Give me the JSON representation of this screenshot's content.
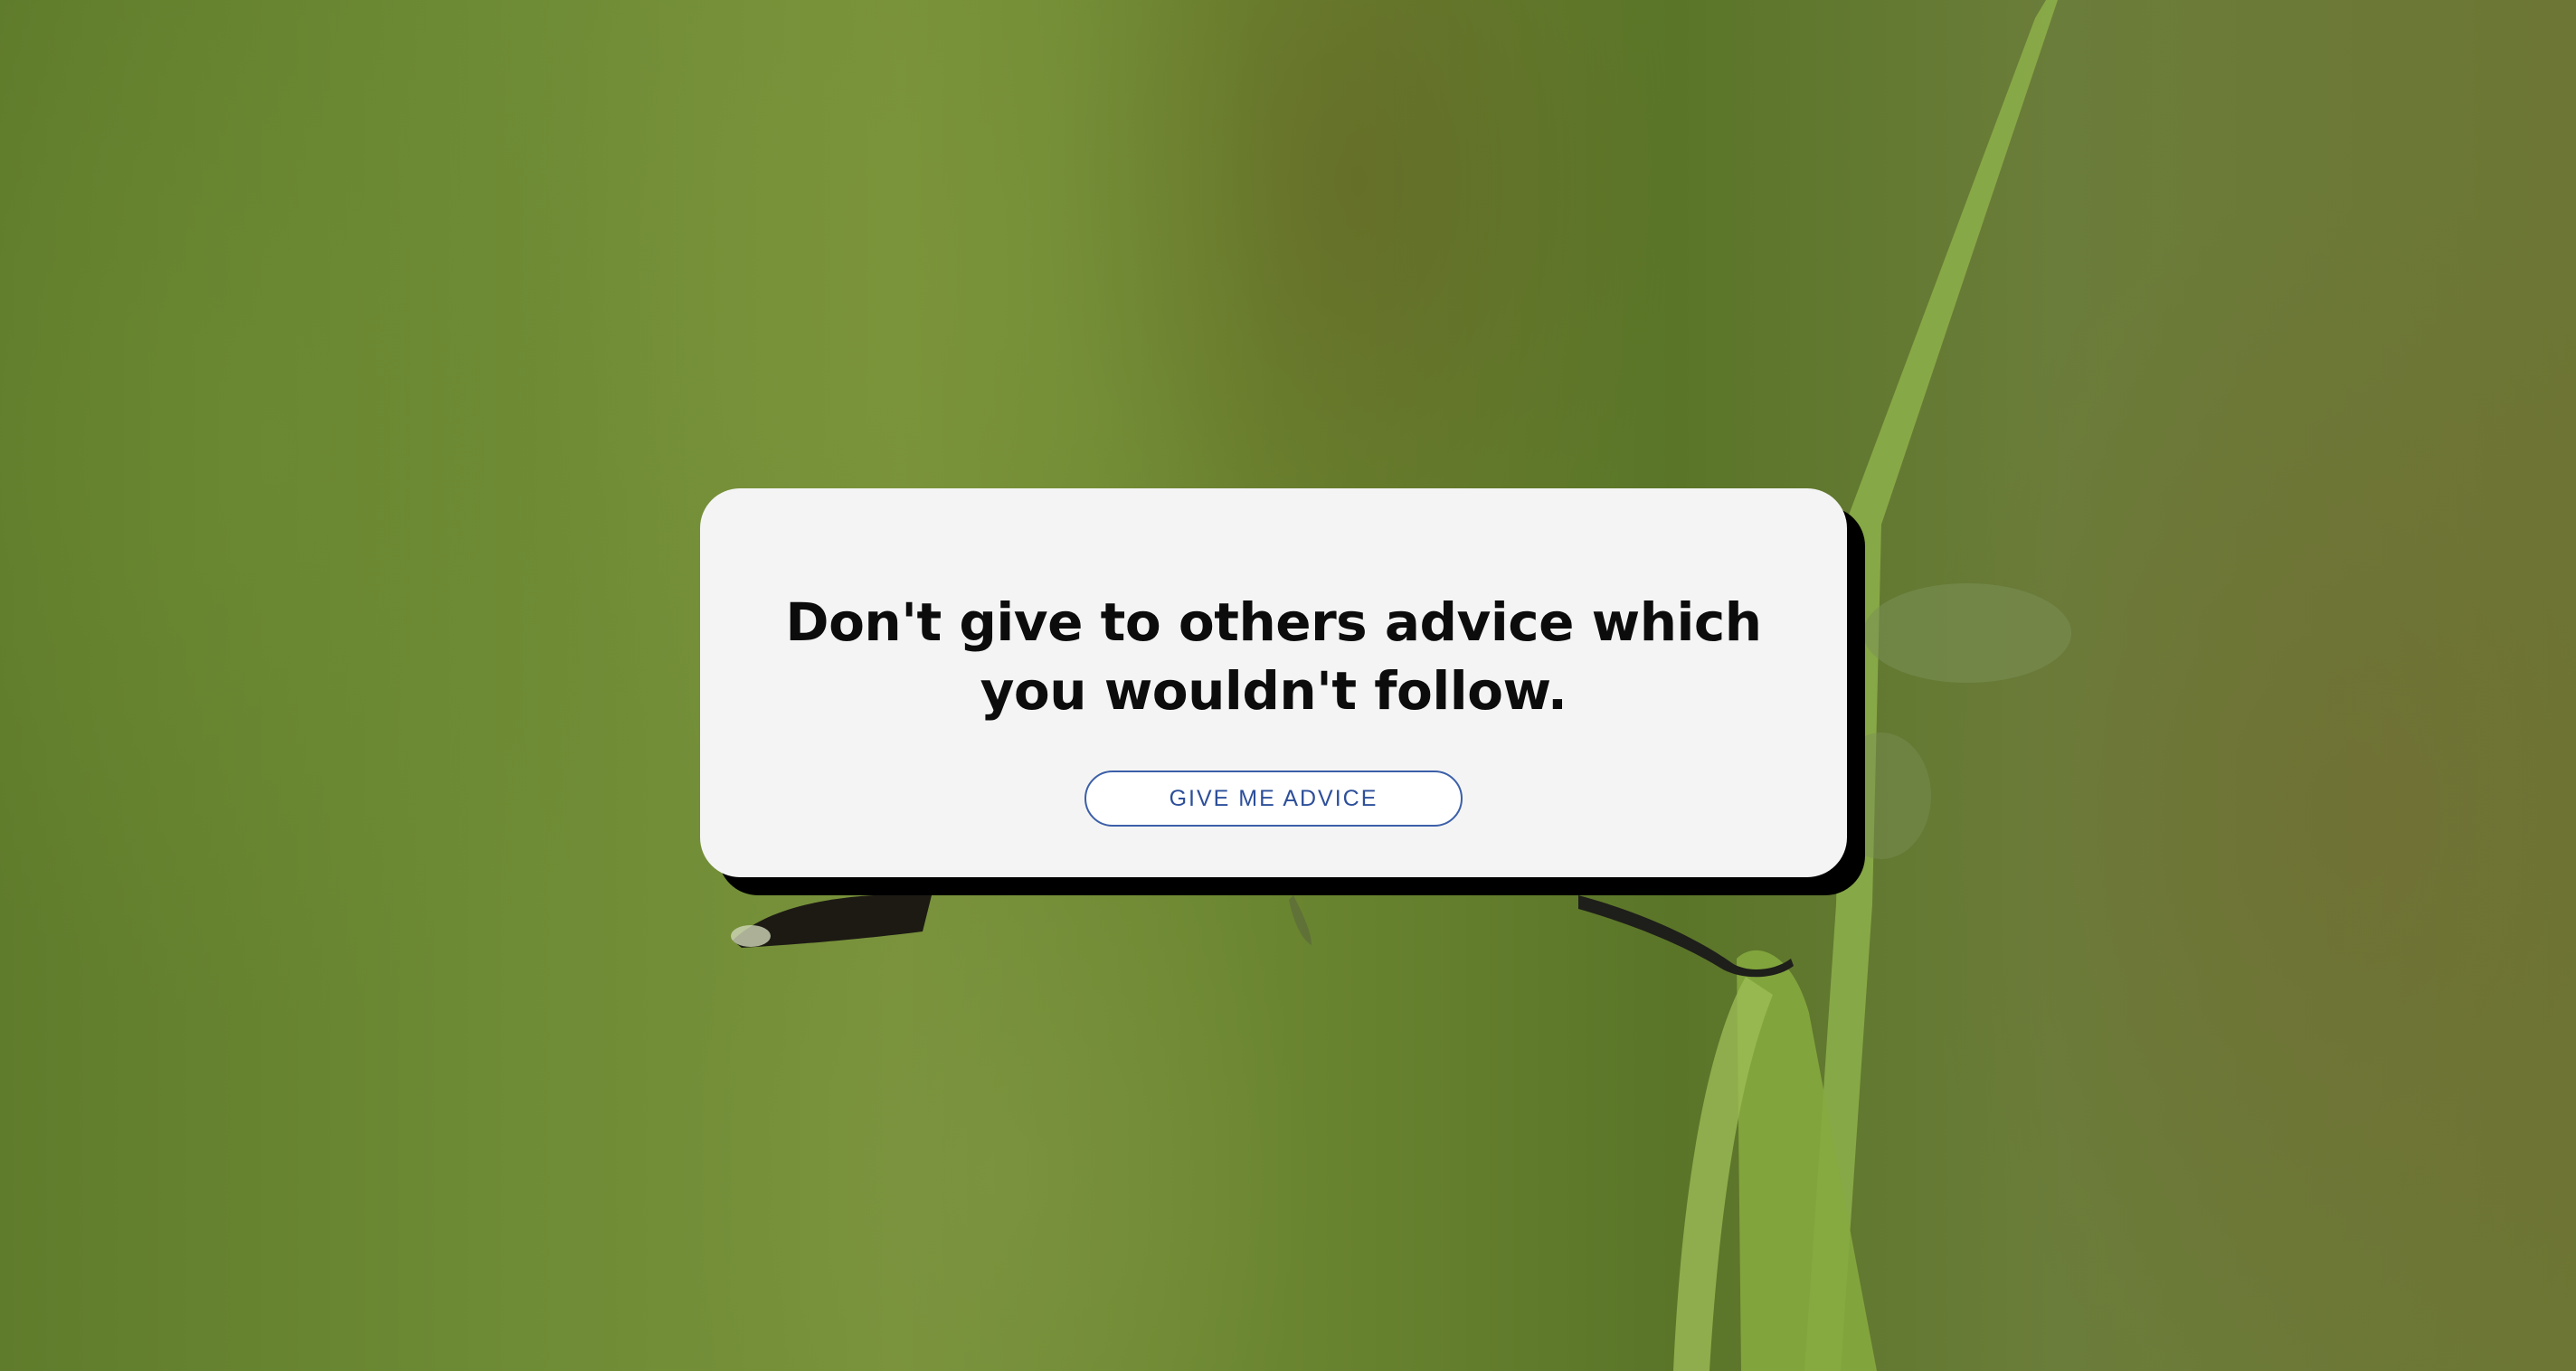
{
  "quote": {
    "text": "Don't give to others advice which you wouldn't follow."
  },
  "actions": {
    "advice_button_label": "GIVE ME ADVICE"
  },
  "colors": {
    "background_green": "#6a8530",
    "card_background": "#f4f4f4",
    "card_shadow": "#000000",
    "button_accent": "#3b5fa8",
    "quote_text": "#0c0c0c"
  }
}
